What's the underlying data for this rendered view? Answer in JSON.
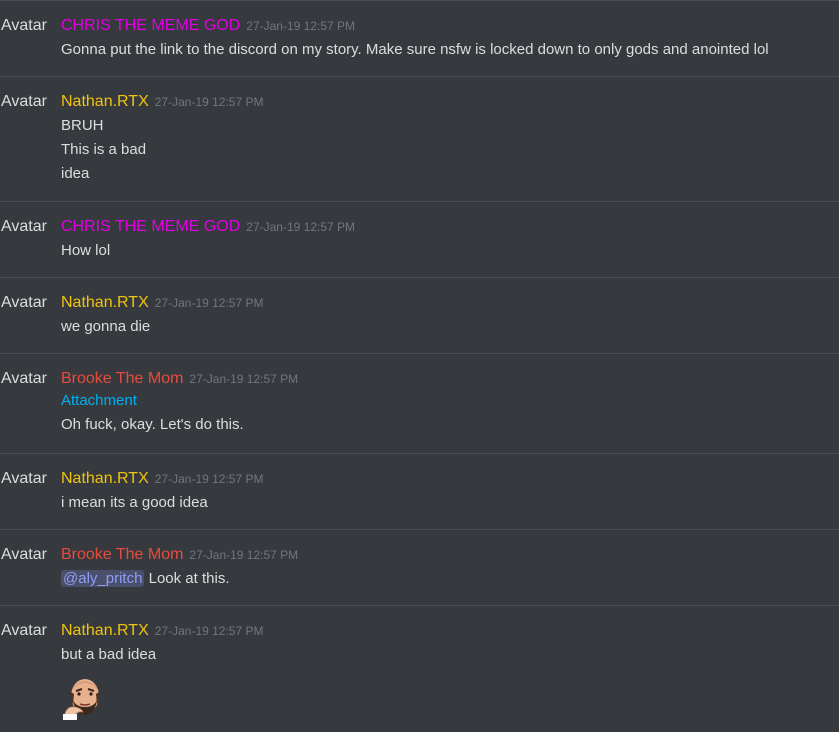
{
  "colors": {
    "chris": "#e200e2",
    "nathan": "#f1c40f",
    "brooke": "#e74c3c",
    "attachment": "#00b0f4",
    "timestamp": "#72767d"
  },
  "messages": [
    {
      "avatar": "Avatar",
      "author": "CHRIS THE MEME GOD",
      "time": "27-Jan-19 12:57 PM",
      "lines": [
        "Gonna put the link to the discord on my story. Make sure nsfw is locked down to only gods and anointed lol"
      ]
    },
    {
      "avatar": "Avatar",
      "author": "Nathan.RTX",
      "time": "27-Jan-19 12:57 PM",
      "lines": [
        "BRUH",
        "This is a bad",
        "idea"
      ]
    },
    {
      "avatar": "Avatar",
      "author": "CHRIS THE MEME GOD",
      "time": "27-Jan-19 12:57 PM",
      "lines": [
        "How lol"
      ]
    },
    {
      "avatar": "Avatar",
      "author": "Nathan.RTX",
      "time": "27-Jan-19 12:57 PM",
      "lines": [
        "we gonna die"
      ]
    },
    {
      "avatar": "Avatar",
      "author": "Brooke The Mom",
      "time": "27-Jan-19 12:57 PM",
      "attachment": "Attachment",
      "lines": [
        "Oh fuck, okay. Let's do this."
      ]
    },
    {
      "avatar": "Avatar",
      "author": "Nathan.RTX",
      "time": "27-Jan-19 12:57 PM",
      "lines": [
        "i mean its a good idea"
      ]
    },
    {
      "avatar": "Avatar",
      "author": "Brooke The Mom",
      "time": "27-Jan-19 12:57 PM",
      "mention": "@aly_pritch",
      "mention_rest": " Look at this."
    },
    {
      "avatar": "Avatar",
      "author": "Nathan.RTX",
      "time": "27-Jan-19 12:57 PM",
      "lines": [
        "but a bad idea"
      ],
      "emoji": "thinking-face-emoji"
    }
  ]
}
